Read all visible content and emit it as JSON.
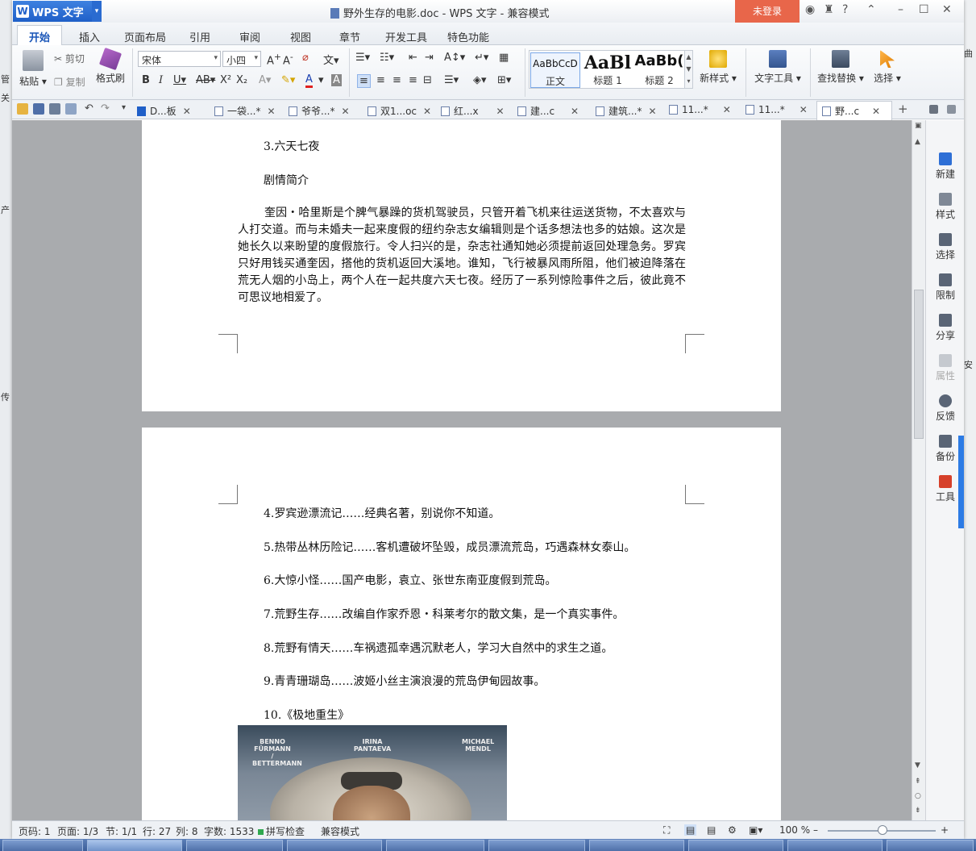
{
  "desktop": {
    "left_fragments": [
      "管",
      "关",
      "产",
      "传"
    ],
    "right_fragments": [
      "曲",
      "安"
    ]
  },
  "titlebar": {
    "app_label": "WPS 文字",
    "title": "野外生存的电影.doc - WPS 文字 - 兼容模式",
    "login_label": "未登录",
    "controls": [
      "?",
      "–",
      "☐",
      "✕"
    ]
  },
  "menu": {
    "items": [
      "开始",
      "插入",
      "页面布局",
      "引用",
      "审阅",
      "视图",
      "章节",
      "开发工具",
      "特色功能"
    ],
    "active": "开始"
  },
  "ribbon": {
    "paste": "粘贴",
    "cut": "剪切",
    "copy": "复制",
    "format_painter": "格式刷",
    "font_name": "宋体",
    "font_size": "小四",
    "styles": [
      {
        "sample": "AaBbCcD",
        "label": "正文"
      },
      {
        "sample": "AaBl",
        "label": "标题 1"
      },
      {
        "sample": "AaBb(",
        "label": "标题 2"
      }
    ],
    "new_style": "新样式",
    "text_tools": "文字工具",
    "find_replace": "查找替换",
    "select": "选择"
  },
  "doc_tabs": [
    {
      "label": "D...板",
      "modified": false
    },
    {
      "label": "一袋...*",
      "modified": true
    },
    {
      "label": "爷爷...*",
      "modified": true
    },
    {
      "label": "双1...oc",
      "modified": false
    },
    {
      "label": "红...x",
      "modified": false
    },
    {
      "label": "建...c",
      "modified": false
    },
    {
      "label": "建筑...*",
      "modified": true
    },
    {
      "label": "11...*",
      "modified": true
    },
    {
      "label": "11...*",
      "modified": true
    },
    {
      "label": "野...c",
      "modified": false
    }
  ],
  "document": {
    "page1_heading1": "3.六天七夜",
    "page1_heading2": "剧情简介",
    "page1_paragraph": "奎因・哈里斯是个脾气暴躁的货机驾驶员，只管开着飞机来往运送货物，不太喜欢与人打交道。而与未婚夫一起来度假的纽约杂志女编辑则是个话多想法也多的姑娘。这次是她长久以来盼望的度假旅行。令人扫兴的是，杂志社通知她必须提前返回处理急务。罗宾只好用钱买通奎因，搭他的货机返回大溪地。谁知，飞行被暴风雨所阻，他们被迫降落在荒无人烟的小岛上，两个人在一起共度六天七夜。经历了一系列惊险事件之后，彼此竟不可思议地相爱了。",
    "page2_items": [
      "4.罗宾逊漂流记……经典名著，别说你不知道。",
      "5.热带丛林历险记……客机遭破坏坠毁，成员漂流荒岛，巧遇森林女泰山。",
      "6.大惊小怪……国产电影，袁立、张世东南亚度假到荒岛。",
      "7.荒野生存……改编自作家乔恩・科莱考尔的散文集，是一个真实事件。",
      "8.荒野有情天……车祸遗孤幸遇沉默老人，学习大自然中的求生之道。",
      "9.青青珊瑚岛……波姬小丝主演浪漫的荒岛伊甸园故事。",
      "10.《极地重生》"
    ],
    "poster_names": [
      "BENNO FÜRMANN / BETTERMANN",
      "IRINA PANTAEVA",
      "MICHAEL MENDL"
    ]
  },
  "right_panel": [
    "新建",
    "样式",
    "选择",
    "限制",
    "分享",
    "属性",
    "反馈",
    "备份",
    "工具"
  ],
  "status": {
    "page_num": "页码: 1",
    "pages": "页面: 1/3",
    "section": "节: 1/1",
    "row": "行: 27",
    "col": "列: 8",
    "words": "字数: 1533",
    "spell": "拼写检查",
    "compat": "兼容模式",
    "zoom": "100 %"
  },
  "colors": {
    "accent": "#1f5fc8",
    "login": "#e8664a",
    "handle": "#2c7be5"
  }
}
